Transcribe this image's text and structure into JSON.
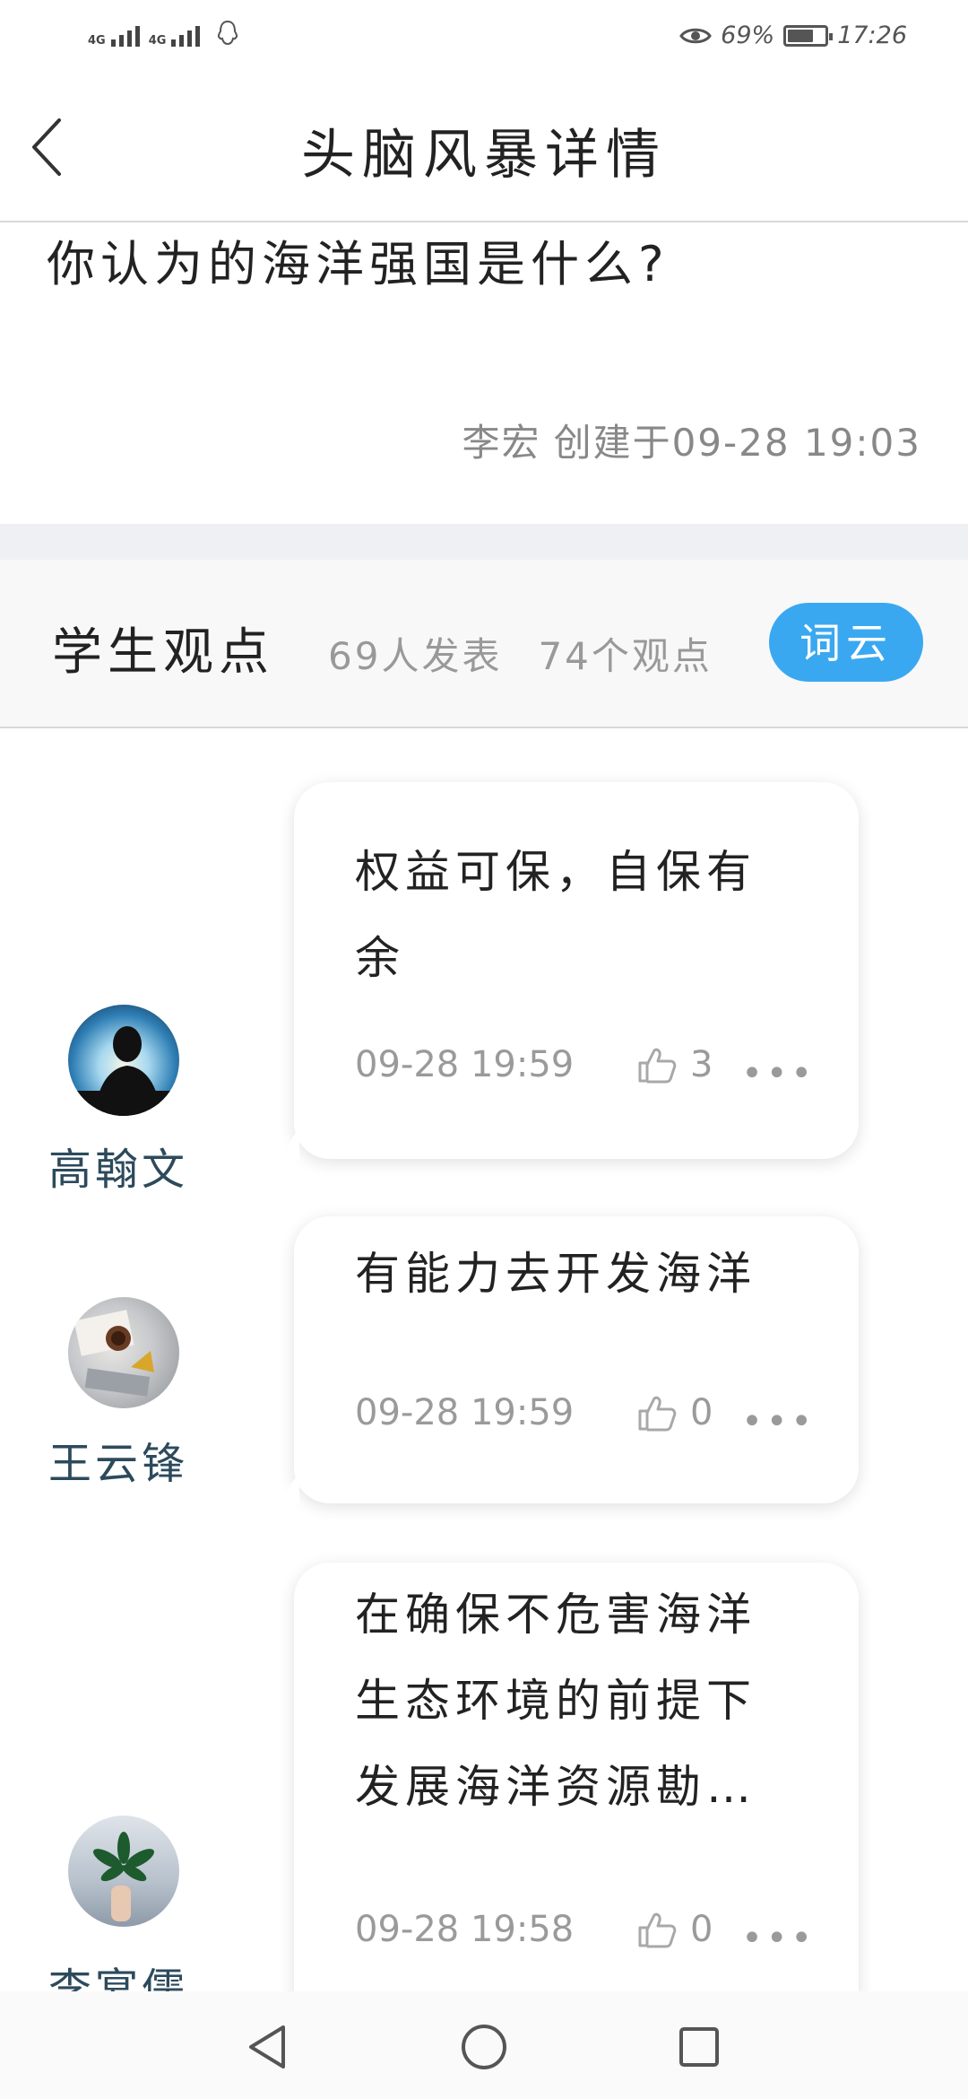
{
  "status_bar": {
    "network1": "4G",
    "network2": "4G",
    "battery": "69%",
    "battery_level": 0.69,
    "time": "17:26"
  },
  "header": {
    "title": "头脑风暴详情"
  },
  "topic": {
    "question": "你认为的海洋强国是什么?",
    "author": "李宏",
    "created": "创建于09-28 19:03"
  },
  "section": {
    "title": "学生观点",
    "participants": "69人发表",
    "opinions": "74个观点",
    "cloud_button": "词云"
  },
  "posts": [
    {
      "author": "高翰文",
      "text": "权益可保，自保有余",
      "time": "09-28 19:59",
      "likes": "3"
    },
    {
      "author": "王云锋",
      "text": "有能力去开发海洋",
      "time": "09-28 19:59",
      "likes": "0"
    },
    {
      "author": "李宴儒",
      "text": "在确保不危害海洋生态环境的前提下发展海洋资源勘…",
      "time": "09-28 19:58",
      "likes": "0"
    }
  ],
  "colors": {
    "accent": "#3aa8f0",
    "author": "#2c4a5c",
    "muted": "#999999"
  },
  "icons": [
    "back-arrow-icon",
    "thumbs-up-icon",
    "more-icon",
    "eye-icon",
    "qq-icon",
    "nav-back-icon",
    "nav-home-icon",
    "nav-recent-icon"
  ]
}
